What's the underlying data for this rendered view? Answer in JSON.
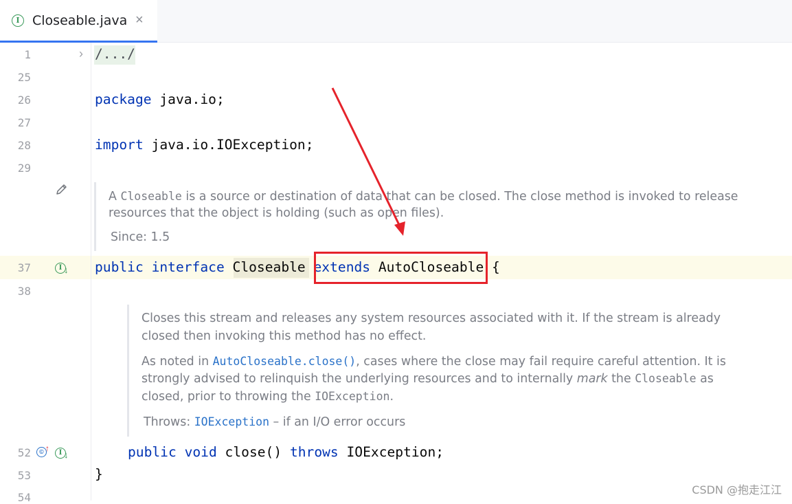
{
  "tab": {
    "label": "Closeable.java",
    "close_glyph": "×",
    "icon": "interface-icon",
    "icon_glyph": "I"
  },
  "line_numbers": [
    "1",
    "25",
    "26",
    "27",
    "28",
    "29",
    "37",
    "38",
    "52",
    "53",
    "54"
  ],
  "code": {
    "folded": "/.../",
    "package_kw": "package",
    "package_name": " java.io;",
    "import_kw": "import",
    "import_name": " java.io.IOException;",
    "iface_public": "public",
    "iface_interface": "interface",
    "iface_name": "Closeable",
    "iface_extends": "extends",
    "iface_parent": " AutoCloseable",
    "iface_brace": " {",
    "method_public": "public",
    "method_void": "void",
    "method_name": " close() ",
    "method_throws": "throws",
    "method_exc": " IOException;",
    "closing_brace": "}"
  },
  "doc_interface": {
    "p1_a": "A ",
    "p1_code": "Closeable",
    "p1_b": " is a source or destination of data that can be closed. The close method is invoked to release",
    "p1_line2": "resources that the object is holding (such as open files).",
    "since_label": "Since:",
    "since_value": "1.5"
  },
  "doc_method": {
    "p1_line1": "Closes this stream and releases any system resources associated with it. If the stream is already",
    "p1_line2": "closed then invoking this method has no effect.",
    "p2_a": "As noted in ",
    "p2_link": "AutoCloseable.close()",
    "p2_b": ", cases where the close may fail require careful attention. It is",
    "p2_line2_a": "strongly advised to relinquish the underlying resources and to internally ",
    "p2_line2_em": "mark",
    "p2_line2_b": " the ",
    "p2_line2_code": "Closeable",
    "p2_line2_c": " as",
    "p2_line3_a": "closed, prior to throwing the ",
    "p2_line3_code": "IOException",
    "p2_line3_b": ".",
    "throws_label": "Throws:",
    "throws_link": "IOException",
    "throws_desc": " – if an I/O error occurs"
  },
  "gutter_icons": [
    "pencil-icon",
    "implemented-interface-icon",
    "override-icon"
  ],
  "annotation": {
    "box_color": "#e5232b",
    "arrow_color": "#e5232b"
  },
  "colors": {
    "keyword": "#0033b3",
    "doc_text": "#7a7d85",
    "link": "#2a72c9",
    "tab_underline": "#3574f0"
  },
  "watermark": "CSDN @抱走江江"
}
